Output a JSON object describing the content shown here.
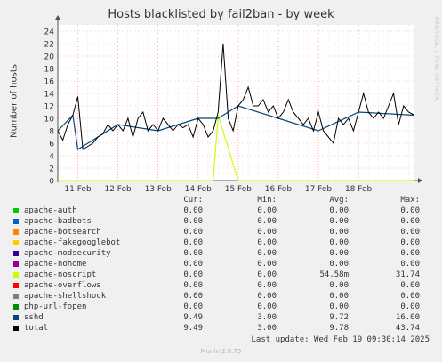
{
  "title": "Hosts blacklisted by fail2ban - by week",
  "ylabel": "Number of hosts",
  "rrd": "RRDTOOL / TOBI OETIKER",
  "legend_headers": {
    "cur": "Cur:",
    "min": "Min:",
    "avg": "Avg:",
    "max": "Max:"
  },
  "legend": [
    {
      "name": "apache-auth",
      "color": "#00cc00",
      "cur": "0.00",
      "min": "0.00",
      "avg": "0.00",
      "max": "0.00"
    },
    {
      "name": "apache-badbots",
      "color": "#0066b3",
      "cur": "0.00",
      "min": "0.00",
      "avg": "0.00",
      "max": "0.00"
    },
    {
      "name": "apache-botsearch",
      "color": "#ff8000",
      "cur": "0.00",
      "min": "0.00",
      "avg": "0.00",
      "max": "0.00"
    },
    {
      "name": "apache-fakegooglebot",
      "color": "#ffcc00",
      "cur": "0.00",
      "min": "0.00",
      "avg": "0.00",
      "max": "0.00"
    },
    {
      "name": "apache-modsecurity",
      "color": "#330099",
      "cur": "0.00",
      "min": "0.00",
      "avg": "0.00",
      "max": "0.00"
    },
    {
      "name": "apache-nohome",
      "color": "#990099",
      "cur": "0.00",
      "min": "0.00",
      "avg": "0.00",
      "max": "0.00"
    },
    {
      "name": "apache-noscript",
      "color": "#ccff00",
      "cur": "0.00",
      "min": "0.00",
      "avg": "54.58m",
      "max": "31.74"
    },
    {
      "name": "apache-overflows",
      "color": "#ff0000",
      "cur": "0.00",
      "min": "0.00",
      "avg": "0.00",
      "max": "0.00"
    },
    {
      "name": "apache-shellshock",
      "color": "#808080",
      "cur": "0.00",
      "min": "0.00",
      "avg": "0.00",
      "max": "0.00"
    },
    {
      "name": "php-url-fopen",
      "color": "#008f00",
      "cur": "0.00",
      "min": "0.00",
      "avg": "0.00",
      "max": "0.00"
    },
    {
      "name": "sshd",
      "color": "#00487d",
      "cur": "9.49",
      "min": "3.00",
      "avg": "9.72",
      "max": "16.00"
    },
    {
      "name": "total",
      "color": "#000000",
      "cur": "9.49",
      "min": "3.00",
      "avg": "9.78",
      "max": "43.74"
    }
  ],
  "last_update": "Last update: Wed Feb 19 09:30:14 2025",
  "munin_version": "Munin 2.0.75",
  "chart_data": {
    "type": "line",
    "title": "Hosts blacklisted by fail2ban - by week",
    "xlabel": "",
    "ylabel": "Number of hosts",
    "ylim": [
      0,
      25
    ],
    "xlim": [
      "2025-02-10T12:00",
      "2025-02-19T09:30"
    ],
    "yticks": [
      0,
      2,
      4,
      6,
      8,
      10,
      12,
      14,
      16,
      18,
      20,
      22,
      24
    ],
    "xticks": [
      "11 Feb",
      "12 Feb",
      "13 Feb",
      "14 Feb",
      "15 Feb",
      "16 Feb",
      "17 Feb",
      "18 Feb"
    ],
    "grid": true,
    "series": [
      {
        "name": "total",
        "color": "#000000",
        "x": [
          "2025-02-10T12:00",
          "2025-02-10T15:00",
          "2025-02-10T18:00",
          "2025-02-10T21:00",
          "2025-02-11T00:00",
          "2025-02-11T03:00",
          "2025-02-11T06:00",
          "2025-02-11T09:00",
          "2025-02-11T12:00",
          "2025-02-11T15:00",
          "2025-02-11T18:00",
          "2025-02-11T21:00",
          "2025-02-12T00:00",
          "2025-02-12T03:00",
          "2025-02-12T06:00",
          "2025-02-12T09:00",
          "2025-02-12T12:00",
          "2025-02-12T15:00",
          "2025-02-12T18:00",
          "2025-02-12T21:00",
          "2025-02-13T00:00",
          "2025-02-13T03:00",
          "2025-02-13T06:00",
          "2025-02-13T09:00",
          "2025-02-13T12:00",
          "2025-02-13T15:00",
          "2025-02-13T18:00",
          "2025-02-13T21:00",
          "2025-02-14T00:00",
          "2025-02-14T03:00",
          "2025-02-14T06:00",
          "2025-02-14T09:00",
          "2025-02-14T12:00",
          "2025-02-14T15:00",
          "2025-02-14T18:00",
          "2025-02-14T21:00",
          "2025-02-15T00:00",
          "2025-02-15T03:00",
          "2025-02-15T06:00",
          "2025-02-15T09:00",
          "2025-02-15T12:00",
          "2025-02-15T15:00",
          "2025-02-15T18:00",
          "2025-02-15T21:00",
          "2025-02-16T00:00",
          "2025-02-16T03:00",
          "2025-02-16T06:00",
          "2025-02-16T09:00",
          "2025-02-16T12:00",
          "2025-02-16T15:00",
          "2025-02-16T18:00",
          "2025-02-16T21:00",
          "2025-02-17T00:00",
          "2025-02-17T03:00",
          "2025-02-17T06:00",
          "2025-02-17T09:00",
          "2025-02-17T12:00",
          "2025-02-17T15:00",
          "2025-02-17T18:00",
          "2025-02-17T21:00",
          "2025-02-18T00:00",
          "2025-02-18T03:00",
          "2025-02-18T06:00",
          "2025-02-18T09:00",
          "2025-02-18T12:00",
          "2025-02-18T15:00",
          "2025-02-18T18:00",
          "2025-02-18T21:00",
          "2025-02-19T00:00",
          "2025-02-19T03:00",
          "2025-02-19T06:00",
          "2025-02-19T09:30"
        ],
        "y": [
          8,
          6.5,
          9,
          10.5,
          13.5,
          5,
          5.5,
          6,
          7,
          7.5,
          9,
          8,
          9,
          8,
          10,
          7,
          10,
          11,
          8,
          9,
          8,
          10,
          9,
          8,
          9,
          8.5,
          9,
          7,
          10,
          9,
          7,
          8,
          11,
          22,
          10,
          8,
          12,
          13,
          15,
          12,
          12,
          13,
          11,
          12,
          10,
          11,
          13,
          11,
          10,
          9,
          10,
          8,
          11,
          8,
          7,
          6,
          10,
          9,
          10,
          8,
          11,
          14,
          11,
          10,
          11,
          10,
          12,
          14,
          9,
          12,
          11,
          10.5
        ]
      },
      {
        "name": "apache-noscript",
        "color": "#ccff00",
        "x": [
          "2025-02-10T12:00",
          "2025-02-10T18:00",
          "2025-02-11T00:00",
          "2025-02-11T06:00",
          "2025-02-12T00:00",
          "2025-02-13T00:00",
          "2025-02-14T00:00",
          "2025-02-14T06:00",
          "2025-02-14T09:00",
          "2025-02-14T12:00",
          "2025-02-15T00:00",
          "2025-02-16T00:00",
          "2025-02-17T00:00",
          "2025-02-18T00:00",
          "2025-02-19T09:30"
        ],
        "y": [
          0,
          0,
          0,
          0,
          0,
          0,
          0,
          0,
          0,
          10.5,
          0,
          0,
          0,
          0,
          0
        ]
      },
      {
        "name": "sshd",
        "color": "#00487d",
        "x": [
          "2025-02-10T12:00",
          "2025-02-10T21:00",
          "2025-02-11T00:00",
          "2025-02-11T06:00",
          "2025-02-12T00:00",
          "2025-02-13T00:00",
          "2025-02-14T00:00",
          "2025-02-14T12:00",
          "2025-02-15T00:00",
          "2025-02-16T00:00",
          "2025-02-17T00:00",
          "2025-02-18T00:00",
          "2025-02-19T09:30"
        ],
        "y": [
          8,
          10.5,
          5,
          6,
          9,
          8,
          10,
          10,
          12,
          10,
          8,
          11,
          10.5
        ]
      }
    ]
  }
}
